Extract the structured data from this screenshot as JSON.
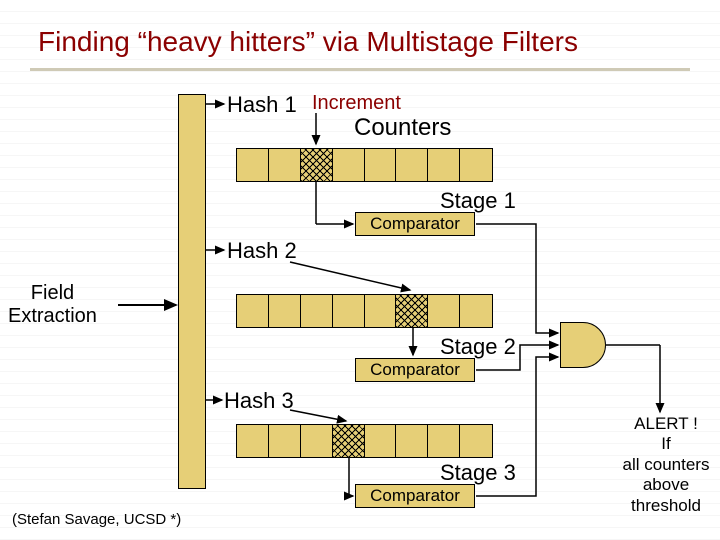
{
  "title": "Finding “heavy hitters” via Multistage Filters",
  "labels": {
    "hash1": "Hash 1",
    "hash2": "Hash 2",
    "hash3": "Hash 3",
    "increment": "Increment",
    "counters": "Counters",
    "stage1": "Stage 1",
    "stage2": "Stage 2",
    "stage3": "Stage 3",
    "comparator": "Comparator",
    "field_extraction": "Field\nExtraction"
  },
  "alert": {
    "line1": "ALERT !",
    "line2": "If",
    "line3": "all counters",
    "line4": "above",
    "line5": "threshold"
  },
  "credit": "(Stefan Savage, UCSD *)",
  "stages": [
    {
      "cells": 8,
      "marked_index": 2
    },
    {
      "cells": 8,
      "marked_index": 5
    },
    {
      "cells": 8,
      "marked_index": 3
    }
  ],
  "colors": {
    "block": "#e6cf77",
    "title": "#8b0000"
  },
  "chart_data": {
    "type": "diagram",
    "description": "Multistage filter: a packet field is extracted, hashed by three independent hash functions into three counter arrays (stages). Each counter is compared to a threshold; if all three comparators fire, an AND gate raises an alert.",
    "input": "Field Extraction",
    "num_stages": 3,
    "counters_per_stage": 8,
    "hashes": [
      "Hash 1",
      "Hash 2",
      "Hash 3"
    ],
    "combine": "AND",
    "output": "ALERT if all counters above threshold"
  }
}
